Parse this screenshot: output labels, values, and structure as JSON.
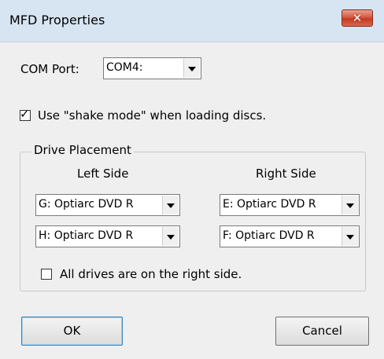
{
  "window": {
    "title": "MFD Properties",
    "close_glyph": "✕"
  },
  "com_port": {
    "label": "COM Port:",
    "value": "COM4:"
  },
  "shake_mode": {
    "label": "Use \"shake mode\" when loading discs.",
    "checked": true
  },
  "drive_placement": {
    "title": "Drive Placement",
    "left_header": "Left Side",
    "right_header": "Right Side",
    "left_drives": [
      "G: Optiarc  DVD R",
      "H: Optiarc  DVD R"
    ],
    "right_drives": [
      "E: Optiarc  DVD R",
      "F: Optiarc  DVD R"
    ]
  },
  "all_right": {
    "label": "All drives are on the right side.",
    "checked": false
  },
  "buttons": {
    "ok": "OK",
    "cancel": "Cancel"
  }
}
